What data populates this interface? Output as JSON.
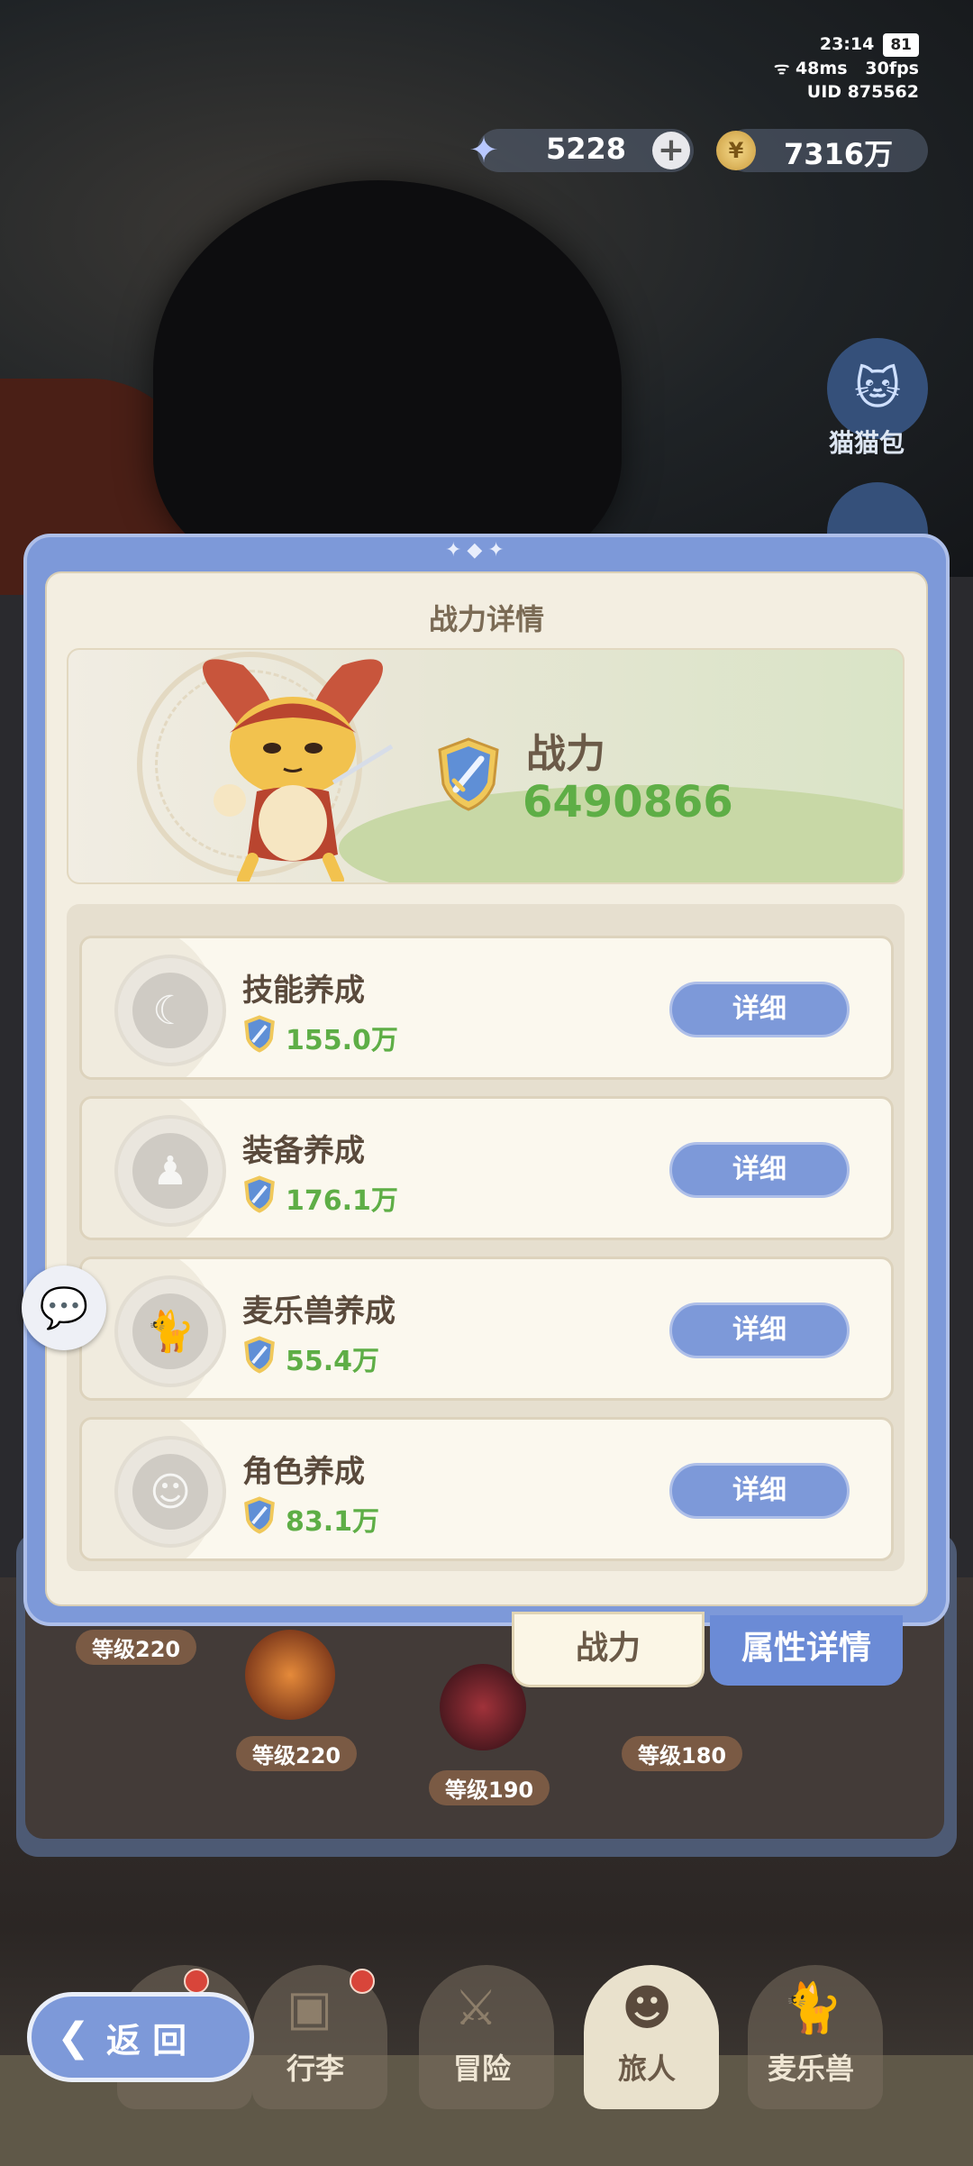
{
  "status": {
    "time": "23:14",
    "battery": "81",
    "ping": "48ms",
    "fps": "30fps",
    "uid": "UID  875562"
  },
  "currency": {
    "gems": "5228",
    "gold": "7316万"
  },
  "side": {
    "bag_label": "猫猫包"
  },
  "background": {
    "levels": [
      "等级220",
      "等级220",
      "等级190",
      "等级180"
    ]
  },
  "dialog": {
    "title": "战力详情",
    "power_label": "战力",
    "power_value": "6490866",
    "items": [
      {
        "title": "技能养成",
        "value": "155.0万",
        "button": "详细",
        "icon": "moon-star-icon"
      },
      {
        "title": "装备养成",
        "value": "176.1万",
        "button": "详细",
        "icon": "figure-icon"
      },
      {
        "title": "麦乐兽养成",
        "value": "55.4万",
        "button": "详细",
        "icon": "cat-icon"
      },
      {
        "title": "角色养成",
        "value": "83.1万",
        "button": "详细",
        "icon": "hero-icon"
      }
    ],
    "tabs": {
      "active": "战力",
      "inactive": "属性详情"
    }
  },
  "nav": {
    "back": "返 回",
    "items": [
      "行李",
      "冒险",
      "旅人",
      "麦乐兽"
    ],
    "active": "旅人"
  },
  "colors": {
    "accent": "#7d99d9",
    "value_green": "#5eae46",
    "panel_cream": "#f3eee1"
  }
}
